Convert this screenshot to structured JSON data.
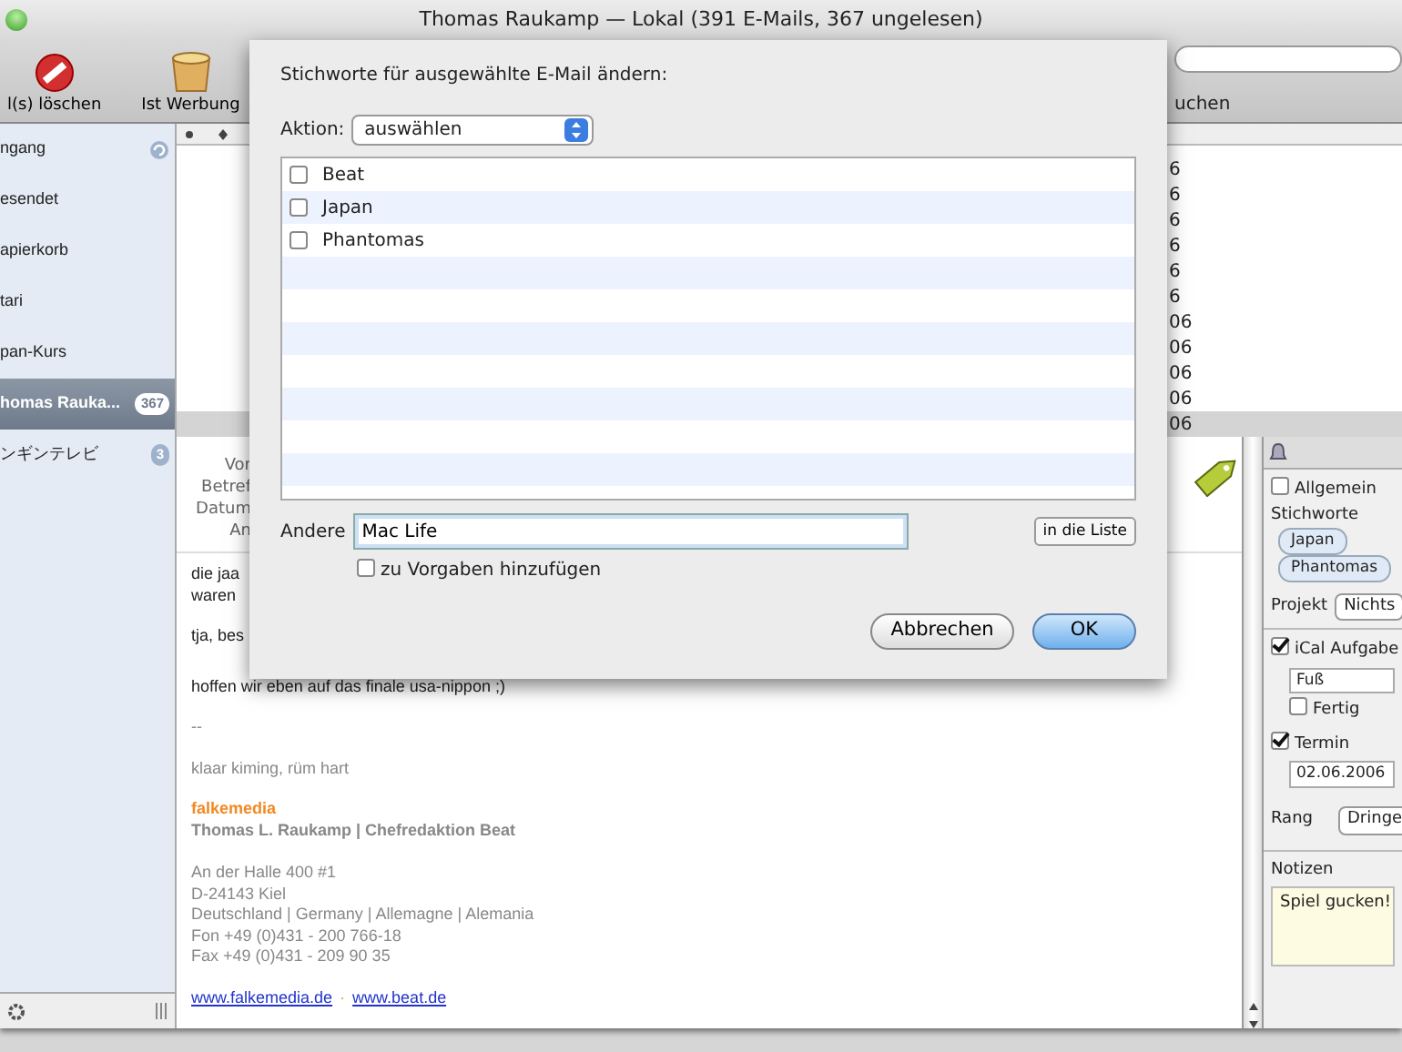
{
  "window": {
    "title": "Thomas Raukamp — Lokal (391 E-Mails, 367 ungelesen)"
  },
  "toolbar": {
    "buttons": [
      {
        "label": "l(s) löschen",
        "kind": "delete"
      },
      {
        "label": "Ist Werbung",
        "kind": "junk"
      }
    ],
    "search_label": "uchen"
  },
  "sidebar": {
    "items": [
      {
        "label": "ngang",
        "kind": "busy",
        "selected": false
      },
      {
        "label": "esendet",
        "kind": "plain",
        "selected": false
      },
      {
        "label": "apierkorb",
        "kind": "plain",
        "selected": false
      },
      {
        "label": "tari",
        "kind": "plain",
        "selected": false
      },
      {
        "label": "pan-Kurs",
        "kind": "plain",
        "selected": false
      },
      {
        "label": "homas Rauka...",
        "kind": "counted",
        "badge": "367",
        "selected": true
      },
      {
        "label": "ンギンテレビ",
        "kind": "counted",
        "badge": "3",
        "selected": false
      }
    ]
  },
  "message_list": {
    "rows": [
      {
        "date": "6",
        "selected": false
      },
      {
        "date": "6",
        "selected": false
      },
      {
        "date": "6",
        "selected": false
      },
      {
        "date": "6",
        "selected": false
      },
      {
        "date": "6",
        "selected": false
      },
      {
        "date": "6",
        "selected": false
      },
      {
        "date": "06",
        "selected": false
      },
      {
        "date": "06",
        "selected": false
      },
      {
        "date": "06",
        "selected": false
      },
      {
        "date": "06",
        "selected": false
      },
      {
        "date": "06",
        "selected": true
      }
    ]
  },
  "message": {
    "header_labels": [
      "Vor",
      "Betref",
      "Datum",
      "An"
    ],
    "body": [
      {
        "kind": "text",
        "lines": [
          "die jaa",
          "waren"
        ]
      },
      {
        "kind": "text",
        "lines": [
          "tja, bes"
        ]
      },
      {
        "kind": "text",
        "lines": [
          "hoffen wir eben auf das finale usa-nippon ;)"
        ]
      },
      {
        "kind": "muted",
        "lines": [
          "--"
        ]
      },
      {
        "kind": "muted",
        "lines": [
          "klaar kiming, rüm hart"
        ]
      },
      {
        "kind": "brand",
        "lines": [
          "falkemedia"
        ]
      },
      {
        "kind": "signature",
        "lines": [
          "Thomas L. Raukamp | Chefredaktion Beat"
        ]
      },
      {
        "kind": "muted",
        "lines": [
          "An der Halle 400 #1",
          "D-24143 Kiel",
          "Deutschland | Germany | Allemagne | Alemania",
          "Fon    +49 (0)431 - 200 766-18",
          "Fax    +49 (0)431 - 209 90 35"
        ]
      },
      {
        "kind": "links",
        "lines": [
          "www.falkemedia.de",
          "www.beat.de"
        ],
        "separator": "·"
      }
    ]
  },
  "inspector": {
    "general": {
      "label": "Allgemein",
      "checked": false
    },
    "keywords_label": "Stichworte",
    "keywords": [
      "Japan",
      "Phantomas"
    ],
    "project": {
      "label": "Projekt",
      "value": "Nichts"
    },
    "ical": {
      "label": "iCal Aufgabe",
      "checked": true,
      "value": "Fuß"
    },
    "done": {
      "label": "Fertig",
      "checked": false
    },
    "due": {
      "label": "Termin",
      "checked": true,
      "value": "02.06.2006"
    },
    "rank": {
      "label": "Rang",
      "value": "Dringe"
    },
    "notes": {
      "label": "Notizen",
      "value": "Spiel gucken!"
    }
  },
  "dialog": {
    "title": "Stichworte für ausgewählte E-Mail ändern:",
    "action_label": "Aktion:",
    "action_value": "auswählen",
    "keywords": [
      {
        "label": "Beat",
        "checked": false
      },
      {
        "label": "Japan",
        "checked": false
      },
      {
        "label": "Phantomas",
        "checked": false
      }
    ],
    "other_label": "Andere",
    "other_value": "Mac Life",
    "add_button": "in die Liste",
    "add_defaults": {
      "label": "zu Vorgaben hinzufügen",
      "checked": false
    },
    "buttons": [
      {
        "label": "Abbrechen",
        "kind": "cancel"
      },
      {
        "label": "OK",
        "kind": "default"
      }
    ]
  }
}
